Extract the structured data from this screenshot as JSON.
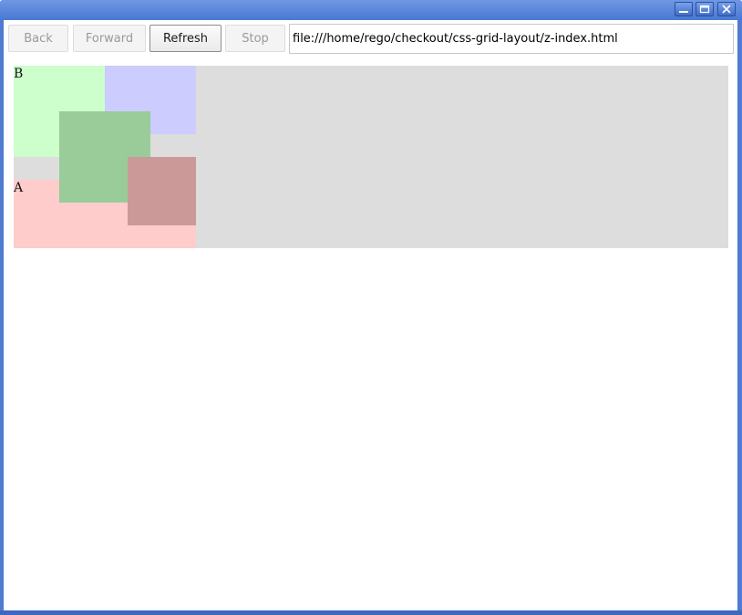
{
  "window": {
    "controls": {
      "minimize_icon": "minimize-icon",
      "maximize_icon": "maximize-icon",
      "close_icon": "close-icon"
    },
    "title_color": "#4a78d2"
  },
  "toolbar": {
    "back_label": "Back",
    "forward_label": "Forward",
    "refresh_label": "Refresh",
    "stop_label": "Stop",
    "url_value": "file:///home/rego/checkout/css-grid-layout/z-index.html"
  },
  "page": {
    "grid_background": "#dddddd",
    "items": [
      {
        "id": "a",
        "label": "A",
        "color": "#ffcccc"
      },
      {
        "id": "b",
        "label": "B",
        "color": "#ccffcc"
      },
      {
        "id": "c",
        "label": "",
        "color": "#ccccff"
      },
      {
        "id": "d",
        "label": "",
        "color": "#99cc99"
      },
      {
        "id": "e",
        "label": "",
        "color": "#cc9999"
      }
    ]
  }
}
